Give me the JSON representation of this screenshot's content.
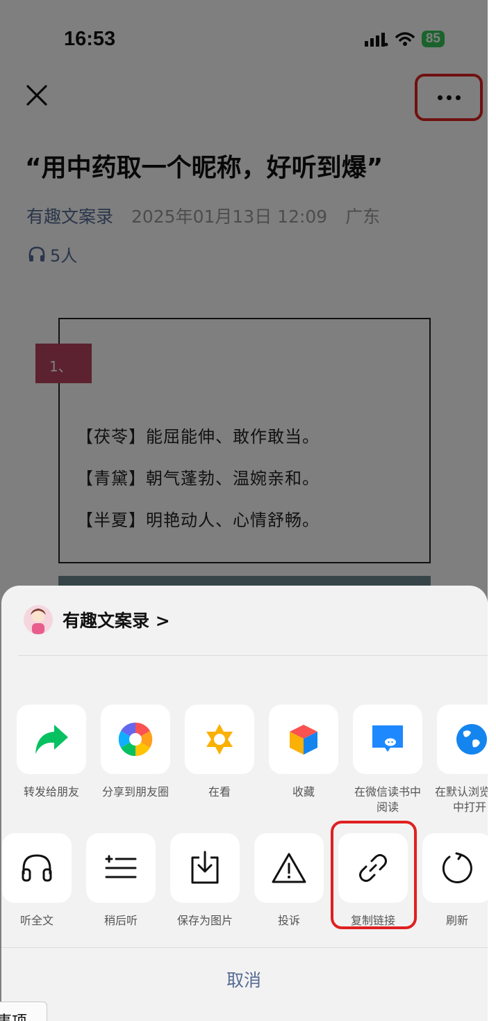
{
  "status": {
    "time": "16:53",
    "battery": "85"
  },
  "article": {
    "title": "“用中药取一个昵称，好听到爆”",
    "author": "有趣文案录",
    "date": "2025年01月13日 12:09",
    "region": "广东",
    "listeners": "5人",
    "tag": "1、",
    "lines": [
      "【茯苓】能屈能伸、敢作敢当。",
      "【青黛】朝气蓬勃、温婉亲和。",
      "【半夏】明艳动人、心情舒畅。"
    ]
  },
  "sheet": {
    "account_name": "有趣文案录 >",
    "row1": [
      {
        "label": "转发给朋友",
        "icon": "share-arrow-icon"
      },
      {
        "label": "分享到朋友圈",
        "icon": "moments-icon"
      },
      {
        "label": "在看",
        "icon": "wow-icon"
      },
      {
        "label": "收藏",
        "icon": "favorite-cube-icon"
      },
      {
        "label": "在微信读书中",
        "label2": "阅读",
        "icon": "weread-icon"
      },
      {
        "label": "在默认浏览",
        "label2": "中打开",
        "icon": "browser-globe-icon"
      }
    ],
    "row2": [
      {
        "label": "听全文",
        "icon": "headphones-icon"
      },
      {
        "label": "稍后听",
        "icon": "listen-later-icon"
      },
      {
        "label": "保存为图片",
        "icon": "save-image-icon"
      },
      {
        "label": "投诉",
        "icon": "warning-icon"
      },
      {
        "label": "复制链接",
        "icon": "link-icon"
      },
      {
        "label": "刷新",
        "icon": "refresh-icon"
      }
    ],
    "cancel": "取消"
  },
  "corner_tab": "事项",
  "colors": {
    "link": "#576b95",
    "highlight": "#e02020",
    "share_green": "#07c160"
  }
}
